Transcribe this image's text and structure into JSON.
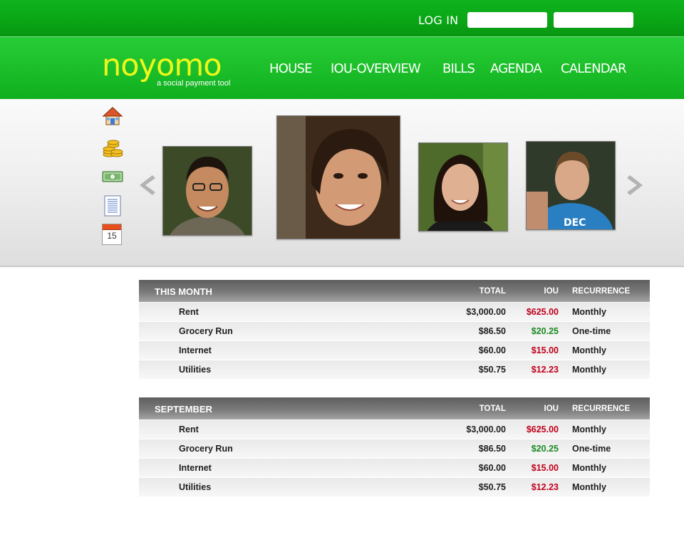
{
  "topbar": {
    "login_label": "LOG IN",
    "username_value": "",
    "password_value": ""
  },
  "brand": {
    "logo": "noyomo",
    "tagline": "a social payment tool",
    "logo_color": "#eef81a",
    "primary_green": "#1cbf2a"
  },
  "nav": {
    "items": [
      "HOUSE",
      "IOU-OVERVIEW",
      "BILLS",
      "AGENDA",
      "CALENDAR"
    ]
  },
  "sidebar": {
    "icons": [
      "house-icon",
      "coins-icon",
      "money-icon",
      "document-icon",
      "calendar-icon"
    ],
    "calendar_day": "15"
  },
  "carousel": {
    "prev": "previous-arrow-icon",
    "next": "next-arrow-icon",
    "photos": [
      "person-photo",
      "person-photo",
      "person-photo",
      "person-photo"
    ]
  },
  "columns": {
    "total": "TOTAL",
    "iou": "IOU",
    "recurrence": "RECURRENCE"
  },
  "colors": {
    "owe": "#c1001b",
    "owed": "#1a8a22"
  },
  "sections": [
    {
      "title": "THIS MONTH",
      "rows": [
        {
          "name": "Rent",
          "total": "$3,000.00",
          "iou": "$625.00",
          "recurrence": "Monthly",
          "status": "owe"
        },
        {
          "name": "Grocery Run",
          "total": "$86.50",
          "iou": "$20.25",
          "recurrence": "One-time",
          "status": "owed"
        },
        {
          "name": "Internet",
          "total": "$60.00",
          "iou": "$15.00",
          "recurrence": "Monthly",
          "status": "owe"
        },
        {
          "name": "Utilities",
          "total": "$50.75",
          "iou": "$12.23",
          "recurrence": "Monthly",
          "status": "owe"
        }
      ]
    },
    {
      "title": "SEPTEMBER",
      "rows": [
        {
          "name": "Rent",
          "total": "$3,000.00",
          "iou": "$625.00",
          "recurrence": "Monthly",
          "status": "owe"
        },
        {
          "name": "Grocery Run",
          "total": "$86.50",
          "iou": "$20.25",
          "recurrence": "One-time",
          "status": "owed"
        },
        {
          "name": "Internet",
          "total": "$60.00",
          "iou": "$15.00",
          "recurrence": "Monthly",
          "status": "owe"
        },
        {
          "name": "Utilities",
          "total": "$50.75",
          "iou": "$12.23",
          "recurrence": "Monthly",
          "status": "owe"
        }
      ]
    }
  ]
}
